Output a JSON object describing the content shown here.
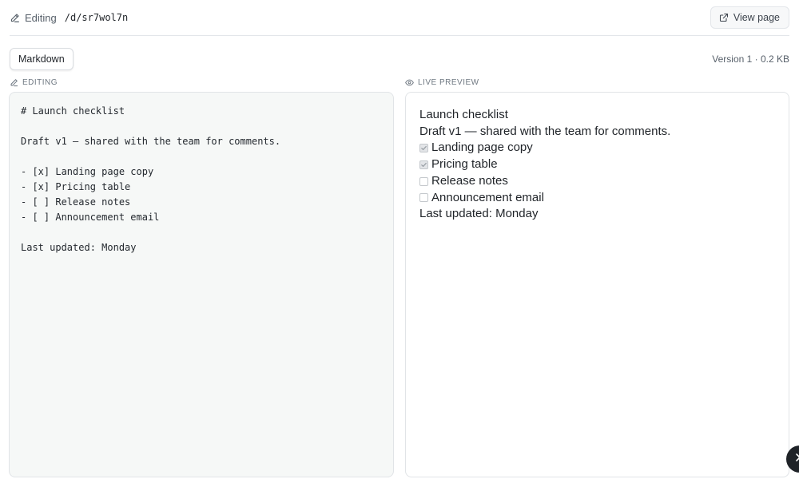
{
  "header": {
    "mode_label": "Editing",
    "path": "/d/sr7wol7n",
    "view_button": "View page"
  },
  "toolbar": {
    "format_tab": "Markdown",
    "version": "Version 1 · 0.2 KB"
  },
  "editor": {
    "label": "EDITING",
    "content": "# Launch checklist\n\nDraft v1 — shared with the team for comments.\n\n- [x] Landing page copy\n- [x] Pricing table\n- [ ] Release notes\n- [ ] Announcement email\n\nLast updated: Monday"
  },
  "preview": {
    "label": "LIVE PREVIEW",
    "heading": "Launch checklist",
    "paragraph": "Draft v1 — shared with the team for comments.",
    "tasks": [
      {
        "label": "Landing page copy",
        "checked": true
      },
      {
        "label": "Pricing table",
        "checked": true
      },
      {
        "label": "Release notes",
        "checked": false
      },
      {
        "label": "Announcement email",
        "checked": false
      }
    ],
    "footer": "Last updated: Monday"
  },
  "icons": {
    "mode": "pencil-icon",
    "view": "external-link-icon",
    "preview": "eye-icon",
    "close": "close-icon"
  }
}
